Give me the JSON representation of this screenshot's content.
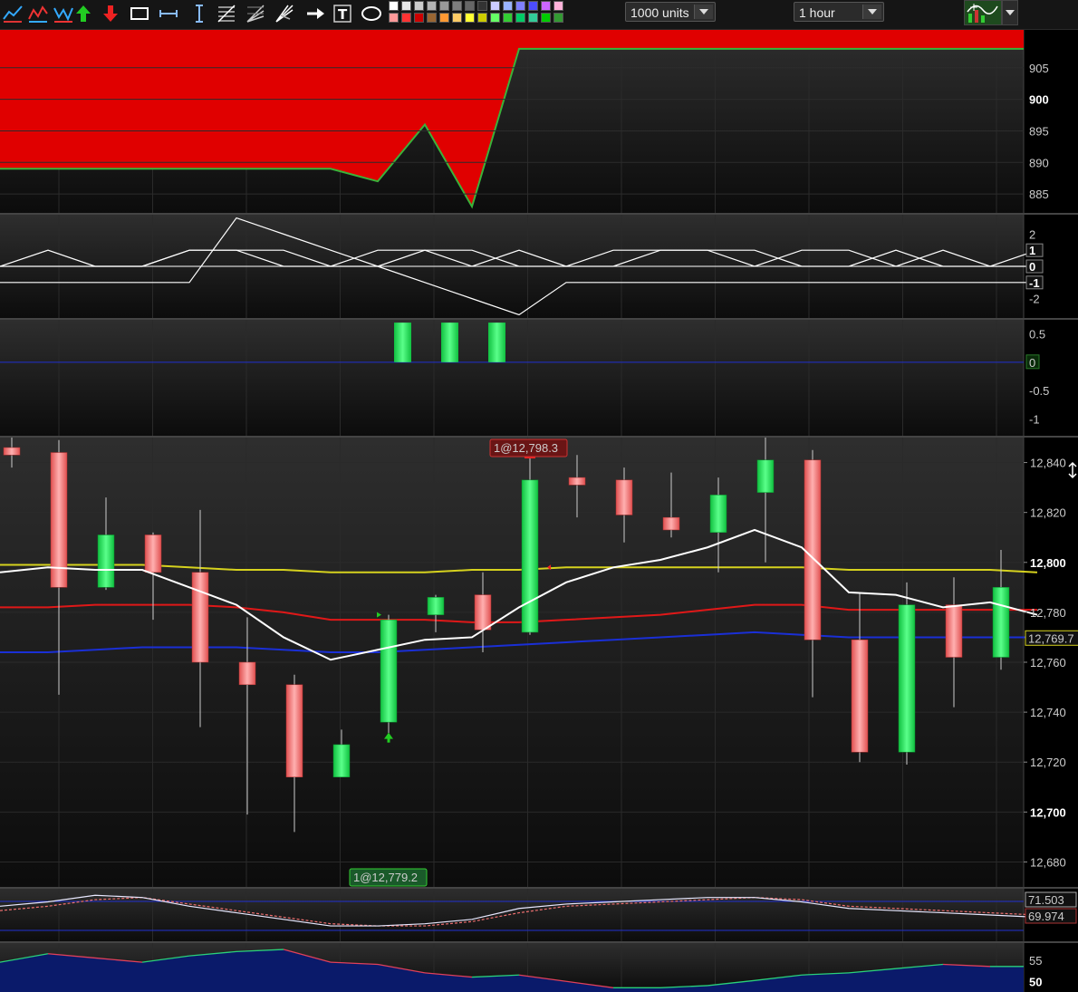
{
  "toolbar": {
    "tools": [
      {
        "name": "line-chart-tool-icon"
      },
      {
        "name": "zigzag-chart-tool-icon"
      },
      {
        "name": "wave-chart-tool-icon"
      },
      {
        "name": "buy-arrow-icon"
      },
      {
        "name": "sell-arrow-icon"
      },
      {
        "name": "rectangle-tool-icon"
      },
      {
        "name": "horizontal-measure-icon"
      },
      {
        "name": "vertical-measure-icon"
      },
      {
        "name": "fibonacci-tool-icon"
      },
      {
        "name": "fibonacci-fan-tool-icon"
      },
      {
        "name": "gann-fan-tool-icon"
      },
      {
        "name": "arrow-tool-icon"
      },
      {
        "name": "text-tool-icon"
      },
      {
        "name": "ellipse-tool-icon"
      }
    ],
    "swatch_rows": [
      [
        "#ffffff",
        "#e6e6e6",
        "#cccccc",
        "#b3b3b3",
        "#999999",
        "#7f7f7f",
        "#666666",
        "#333333",
        "#ccccff",
        "#99b3ff",
        "#7f7fff",
        "#4c4cff",
        "#cc66ff",
        "#ffb3d9"
      ],
      [
        "#ff9999",
        "#ff3333",
        "#cc0000",
        "#996633",
        "#ff9933",
        "#ffcc66",
        "#ffff33",
        "#cccc00",
        "#66ff66",
        "#33cc33",
        "#00cc66",
        "#33cc99",
        "#00cc00",
        "#339933"
      ]
    ],
    "units_select": "1000 units",
    "interval_select": "1 hour"
  },
  "colors": {
    "up": "#19e65a",
    "down": "#f07070",
    "ma_white": "#ffffff",
    "ma_yellow": "#d6d21e",
    "ma_red": "#e01818",
    "ma_blue": "#1a2fd6",
    "area_red": "#e00000",
    "area_line": "#3ab33a"
  },
  "panels": {
    "equity": {
      "ticks": [
        {
          "label": "905",
          "bold": false
        },
        {
          "label": "900",
          "bold": true
        },
        {
          "label": "895",
          "bold": false
        },
        {
          "label": "890",
          "bold": false
        },
        {
          "label": "885",
          "bold": false
        }
      ]
    },
    "oscillator": {
      "ticks": [
        "2",
        "1",
        "0",
        "-1",
        "-2"
      ],
      "highlight": [
        "1",
        "0",
        "-1"
      ]
    },
    "histogram": {
      "ticks": [
        "0.5",
        "0",
        "-0.5",
        "-1"
      ],
      "zero_label": "0"
    },
    "price": {
      "ticks": [
        {
          "label": "12,840",
          "bold": false
        },
        {
          "label": "12,820",
          "bold": false
        },
        {
          "label": "12,800",
          "bold": true
        },
        {
          "label": "12,780",
          "bold": false
        },
        {
          "label": "12,760",
          "bold": false
        },
        {
          "label": "12,740",
          "bold": false
        },
        {
          "label": "12,720",
          "bold": false
        },
        {
          "label": "12,700",
          "bold": true
        },
        {
          "label": "12,680",
          "bold": false
        }
      ],
      "last_price": "12,769.7",
      "sell_tag": "1@12,798.3",
      "buy_tag": "1@12,779.2"
    },
    "rsi": {
      "label_a": "71.503",
      "label_b": "69.974"
    },
    "adx": {
      "ticks": [
        {
          "label": "55",
          "bold": false
        },
        {
          "label": "50",
          "bold": true
        }
      ]
    }
  },
  "chart_data": {
    "type": "candlestick",
    "ylim": [
      12670,
      12850
    ],
    "candles": [
      {
        "o": 12846,
        "h": 12850,
        "l": 12838,
        "c": 12843
      },
      {
        "o": 12844,
        "h": 12849,
        "l": 12747,
        "c": 12790
      },
      {
        "o": 12790,
        "h": 12826,
        "l": 12789,
        "c": 12811
      },
      {
        "o": 12811,
        "h": 12812,
        "l": 12777,
        "c": 12796
      },
      {
        "o": 12796,
        "h": 12821,
        "l": 12734,
        "c": 12760
      },
      {
        "o": 12760,
        "h": 12778,
        "l": 12699,
        "c": 12751
      },
      {
        "o": 12751,
        "h": 12755,
        "l": 12692,
        "c": 12714
      },
      {
        "o": 12714,
        "h": 12733,
        "l": 12714,
        "c": 12727
      },
      {
        "o": 12736,
        "h": 12779,
        "l": 12731,
        "c": 12777
      },
      {
        "o": 12779,
        "h": 12787,
        "l": 12772,
        "c": 12786
      },
      {
        "o": 12787,
        "h": 12796,
        "l": 12764,
        "c": 12773
      },
      {
        "o": 12772,
        "h": 12842,
        "l": 12771,
        "c": 12833
      },
      {
        "o": 12834,
        "h": 12843,
        "l": 12818,
        "c": 12831
      },
      {
        "o": 12833,
        "h": 12838,
        "l": 12808,
        "c": 12819
      },
      {
        "o": 12818,
        "h": 12836,
        "l": 12810,
        "c": 12813
      },
      {
        "o": 12812,
        "h": 12834,
        "l": 12796,
        "c": 12827
      },
      {
        "o": 12828,
        "h": 12850,
        "l": 12800,
        "c": 12841
      },
      {
        "o": 12841,
        "h": 12845,
        "l": 12746,
        "c": 12769
      },
      {
        "o": 12769,
        "h": 12788,
        "l": 12720,
        "c": 12724
      },
      {
        "o": 12724,
        "h": 12792,
        "l": 12719,
        "c": 12783
      },
      {
        "o": 12783,
        "h": 12794,
        "l": 12742,
        "c": 12762
      },
      {
        "o": 12762,
        "h": 12805,
        "l": 12757,
        "c": 12790
      }
    ],
    "ma_white": [
      12796,
      12798,
      12797,
      12797,
      12790,
      12783,
      12770,
      12761,
      12765,
      12769,
      12770,
      12782,
      12792,
      12798,
      12801,
      12806,
      12813,
      12806,
      12788,
      12787,
      12782,
      12784,
      12779
    ],
    "ma_yellow": [
      12799,
      12799,
      12799,
      12799,
      12798,
      12797,
      12797,
      12796,
      12796,
      12796,
      12797,
      12797,
      12798,
      12798,
      12798,
      12798,
      12798,
      12798,
      12797,
      12797,
      12797,
      12797,
      12796
    ],
    "ma_red": [
      12782,
      12782,
      12783,
      12783,
      12783,
      12782,
      12780,
      12777,
      12777,
      12777,
      12776,
      12776,
      12777,
      12778,
      12779,
      12781,
      12783,
      12783,
      12781,
      12781,
      12781,
      12781,
      12781
    ],
    "ma_blue": [
      12764,
      12764,
      12765,
      12766,
      12766,
      12766,
      12765,
      12764,
      12764,
      12765,
      12766,
      12767,
      12768,
      12769,
      12770,
      12771,
      12772,
      12771,
      12770,
      12770,
      12770,
      12770,
      12770
    ],
    "equity_line": [
      889,
      889,
      889,
      889,
      889,
      889,
      889,
      889,
      887,
      896,
      883,
      908,
      908,
      908,
      908,
      908,
      908,
      908,
      908,
      908,
      908,
      908,
      908
    ],
    "histogram": [
      0,
      0,
      0,
      0,
      0,
      0,
      0,
      0,
      1,
      1,
      1,
      0,
      0,
      0,
      0,
      0,
      0,
      0,
      0,
      0,
      0,
      0
    ],
    "osc_a": [
      0,
      1,
      0,
      0,
      1,
      1,
      1,
      0,
      0,
      1,
      0,
      1,
      0,
      0,
      1,
      1,
      0,
      1,
      1,
      0,
      1,
      0,
      1
    ],
    "osc_b": [
      0,
      0,
      0,
      0,
      1,
      1,
      0,
      0,
      1,
      1,
      1,
      0,
      0,
      1,
      1,
      1,
      1,
      0,
      0,
      1,
      0,
      0,
      0
    ],
    "osc_c": [
      -1,
      -1,
      -1,
      -1,
      -1,
      3,
      2,
      1,
      0,
      -1,
      -2,
      -3,
      -1,
      -1,
      -1,
      -1,
      -1,
      -1,
      -1,
      -1,
      -1,
      -1,
      -1
    ],
    "rsi_a": [
      71.2,
      71.4,
      71.7,
      71.6,
      71.2,
      70.9,
      70.6,
      70.3,
      70.3,
      70.4,
      70.6,
      71.1,
      71.3,
      71.4,
      71.5,
      71.6,
      71.6,
      71.4,
      71.1,
      71.0,
      70.9,
      70.8,
      70.7
    ],
    "rsi_b": [
      71.0,
      71.2,
      71.5,
      71.6,
      71.3,
      71.0,
      70.7,
      70.4,
      70.3,
      70.3,
      70.5,
      70.9,
      71.2,
      71.3,
      71.4,
      71.5,
      71.6,
      71.5,
      71.2,
      71.1,
      71.0,
      70.9,
      70.8
    ],
    "adx": [
      54.5,
      56.5,
      55.5,
      54.5,
      56,
      57,
      57.5,
      54.5,
      54,
      52,
      51,
      51.5,
      50,
      48.5,
      48.5,
      49,
      50.2,
      51.5,
      52,
      53,
      54,
      53.5,
      53.5
    ]
  }
}
